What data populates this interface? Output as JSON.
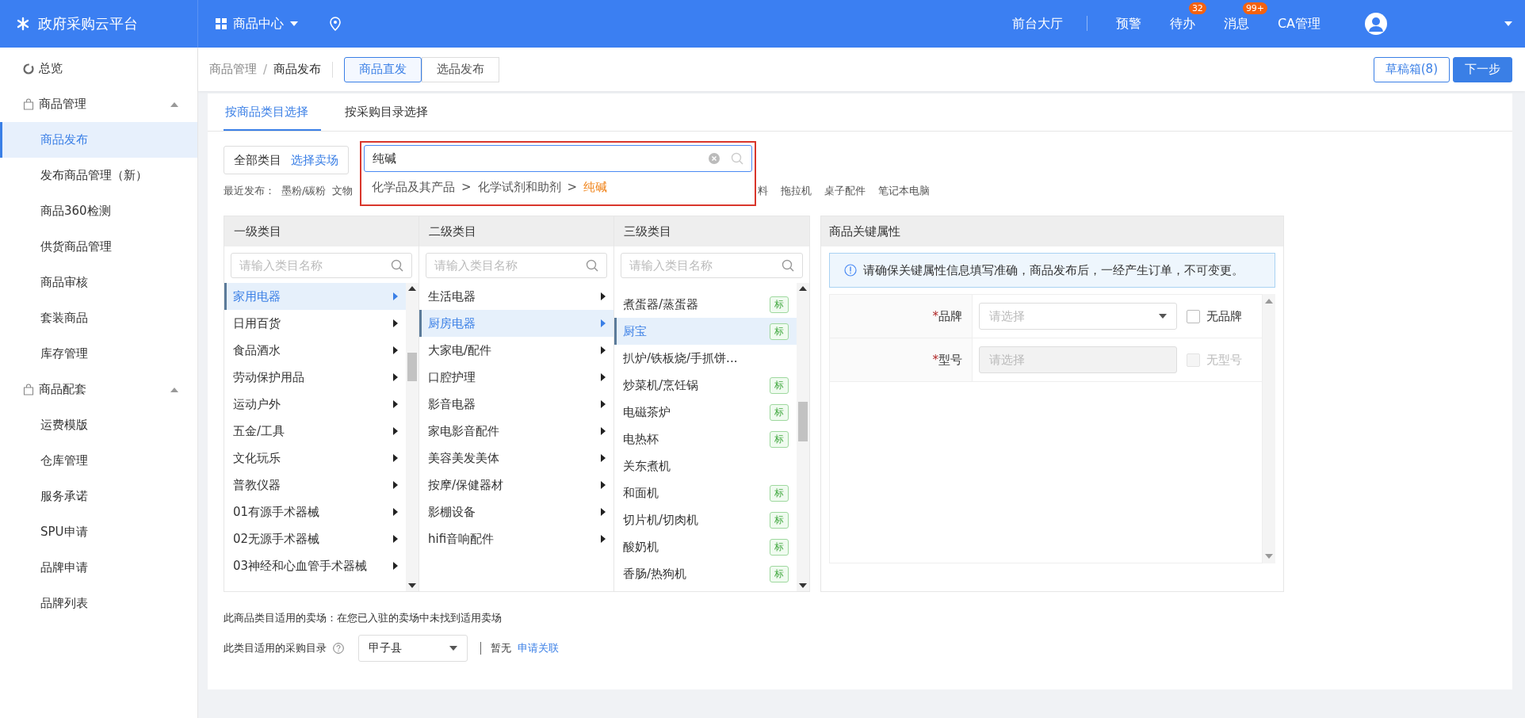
{
  "header": {
    "brand": "政府采购云平台",
    "module": "商品中心",
    "nav": [
      {
        "label": "前台大厅",
        "divider_after": true
      },
      {
        "label": "预警",
        "divider_after": false
      },
      {
        "label": "待办",
        "badge": "32",
        "divider_after": false
      },
      {
        "label": "消息",
        "badge": "99+",
        "divider_after": false
      },
      {
        "label": "CA管理",
        "divider_after": false
      }
    ]
  },
  "sidebar": {
    "items": [
      {
        "label": "总览",
        "kind": "link",
        "selected": false
      },
      {
        "label": "商品管理",
        "kind": "group",
        "expanded": true,
        "children": [
          {
            "label": "商品发布",
            "selected": true
          },
          {
            "label": "发布商品管理（新）",
            "selected": false
          },
          {
            "label": "商品360检测",
            "selected": false
          },
          {
            "label": "供货商品管理",
            "selected": false
          },
          {
            "label": "商品审核",
            "selected": false
          },
          {
            "label": "套装商品",
            "selected": false
          },
          {
            "label": "库存管理",
            "selected": false
          }
        ]
      },
      {
        "label": "商品配套",
        "kind": "group",
        "expanded": true,
        "children": [
          {
            "label": "运费模版",
            "selected": false
          },
          {
            "label": "仓库管理",
            "selected": false
          },
          {
            "label": "服务承诺",
            "selected": false
          },
          {
            "label": "SPU申请",
            "selected": false
          },
          {
            "label": "品牌申请",
            "selected": false
          },
          {
            "label": "品牌列表",
            "selected": false
          }
        ]
      }
    ]
  },
  "toolbar": {
    "breadcrumb": [
      "商品管理",
      "商品发布"
    ],
    "separator": "/",
    "modes": [
      {
        "label": "商品直发",
        "selected": true
      },
      {
        "label": "选品发布",
        "selected": false
      }
    ],
    "buttons": [
      {
        "label": "草稿箱(8)",
        "kind": "outline"
      },
      {
        "label": "下一步",
        "kind": "primary"
      }
    ]
  },
  "tabs": [
    {
      "label": "按商品类目选择",
      "selected": true
    },
    {
      "label": "按采购目录选择",
      "selected": false
    }
  ],
  "scope": {
    "label": "全部类目",
    "link": "选择卖场"
  },
  "search": {
    "value": "纯碱",
    "suggestion": {
      "path": [
        "化学品及其产品",
        "化学试剂和助剂"
      ],
      "separator": ">",
      "match": "纯碱"
    }
  },
  "recent": {
    "label": "最近发布：",
    "before": [
      "墨粉/碳粉",
      "文物"
    ],
    "after": [
      "料",
      "拖拉机",
      "桌子配件",
      "笔记本电脑"
    ]
  },
  "columns": [
    {
      "title": "一级类目",
      "placeholder": "请输入类目名称",
      "kind": "branch",
      "scrollbar": true,
      "items": [
        {
          "label": "家用电器",
          "selected": true
        },
        {
          "label": "日用百货",
          "selected": false
        },
        {
          "label": "食品酒水",
          "selected": false
        },
        {
          "label": "劳动保护用品",
          "selected": false
        },
        {
          "label": "运动户外",
          "selected": false
        },
        {
          "label": "五金/工具",
          "selected": false
        },
        {
          "label": "文化玩乐",
          "selected": false
        },
        {
          "label": "普教仪器",
          "selected": false
        },
        {
          "label": "01有源手术器械",
          "selected": false
        },
        {
          "label": "02无源手术器械",
          "selected": false
        },
        {
          "label": "03神经和心血管手术器械",
          "selected": false
        }
      ]
    },
    {
      "title": "二级类目",
      "placeholder": "请输入类目名称",
      "kind": "branch",
      "scrollbar": false,
      "items": [
        {
          "label": "生活电器",
          "selected": false
        },
        {
          "label": "厨房电器",
          "selected": true
        },
        {
          "label": "大家电/配件",
          "selected": false
        },
        {
          "label": "口腔护理",
          "selected": false
        },
        {
          "label": "影音电器",
          "selected": false
        },
        {
          "label": "家电影音配件",
          "selected": false
        },
        {
          "label": "美容美发美体",
          "selected": false
        },
        {
          "label": "按摩/保健器材",
          "selected": false
        },
        {
          "label": "影棚设备",
          "selected": false
        },
        {
          "label": "hifi音响配件",
          "selected": false
        }
      ]
    },
    {
      "title": "三级类目",
      "placeholder": "请输入类目名称",
      "kind": "leaf",
      "scrollbar": true,
      "items": [
        {
          "label": "煮蛋器/蒸蛋器",
          "selected": false,
          "tag": "标"
        },
        {
          "label": "厨宝",
          "selected": true,
          "tag": "标"
        },
        {
          "label": "扒炉/铁板烧/手抓饼...",
          "selected": false
        },
        {
          "label": "炒菜机/烹饪锅",
          "selected": false,
          "tag": "标"
        },
        {
          "label": "电磁茶炉",
          "selected": false,
          "tag": "标"
        },
        {
          "label": "电热杯",
          "selected": false,
          "tag": "标"
        },
        {
          "label": "关东煮机",
          "selected": false
        },
        {
          "label": "和面机",
          "selected": false,
          "tag": "标"
        },
        {
          "label": "切片机/切肉机",
          "selected": false,
          "tag": "标"
        },
        {
          "label": "酸奶机",
          "selected": false,
          "tag": "标"
        },
        {
          "label": "香肠/热狗机",
          "selected": false,
          "tag": "标"
        }
      ]
    }
  ],
  "attributes": {
    "title": "商品关键属性",
    "notice": "请确保关键属性信息填写准确，商品发布后，一经产生订单，不可变更。",
    "fields": [
      {
        "label": "品牌",
        "marker": "*",
        "placeholder": "请选择",
        "kind": "select",
        "disabled": false,
        "option": {
          "label": "无品牌",
          "checked": false
        }
      },
      {
        "label": "型号",
        "marker": "*",
        "placeholder": "请选择",
        "kind": "input",
        "disabled": true,
        "option": {
          "label": "无型号",
          "checked": false
        }
      }
    ]
  },
  "footer": {
    "market": "此商品类目适用的卖场：在您已入驻的卖场中未找到适用卖场",
    "catalog_label": "此类目适用的采购目录",
    "catalog_value": "甲子县",
    "status": "暂无",
    "link": "申请关联"
  }
}
